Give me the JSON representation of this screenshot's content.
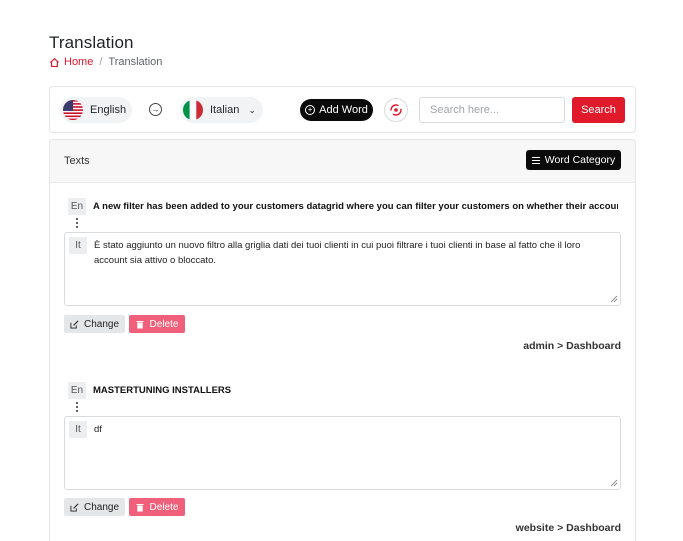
{
  "page": {
    "title": "Translation",
    "breadcrumb": {
      "home": "Home",
      "separator": "/",
      "current": "Translation"
    }
  },
  "toolbar": {
    "source_language": "English",
    "target_language": "Italian",
    "add_word_label": "Add Word",
    "search_placeholder": "Search here...",
    "search_button": "Search"
  },
  "texts_card": {
    "title": "Texts",
    "word_category_label": "Word Category",
    "entries": [
      {
        "source_lang": "En",
        "source_text": "A new filter has been added to your customers datagrid where you can filter your customers on whether their account is acti",
        "target_lang": "It",
        "target_text": "È stato aggiunto un nuovo filtro alla griglia dati dei tuoi clienti in cui puoi filtrare i tuoi clienti in base al fatto che il loro account sia attivo o bloccato.",
        "change_label": "Change",
        "delete_label": "Delete",
        "path": "admin > Dashboard"
      },
      {
        "source_lang": "En",
        "source_text": "MASTERTUNING INSTALLERS",
        "target_lang": "It",
        "target_text": "df",
        "change_label": "Change",
        "delete_label": "Delete",
        "path": "website > Dashboard"
      }
    ]
  },
  "colors": {
    "accent_red": "#e0192b",
    "delete_pink": "#f0607a",
    "dark_button": "#0b0b0b"
  }
}
